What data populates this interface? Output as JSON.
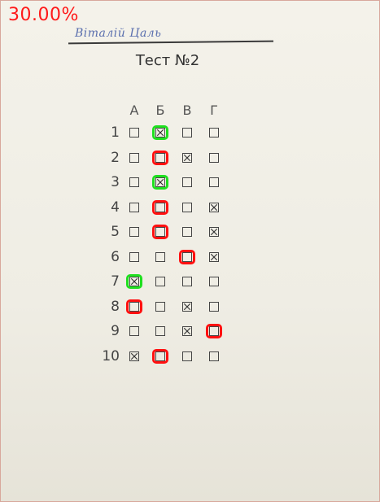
{
  "score": "30.00%",
  "student_name": "Віталій Цаль",
  "title": "Тест №2",
  "columns": [
    "А",
    "Б",
    "В",
    "Г"
  ],
  "colors": {
    "correct": "#1fe01f",
    "wrong": "#ff1010",
    "score": "#ff1a1a"
  },
  "rows": [
    {
      "num": "1",
      "marked": 1,
      "result": "correct",
      "ring": 1
    },
    {
      "num": "2",
      "marked": 2,
      "result": "wrong",
      "ring": 1
    },
    {
      "num": "3",
      "marked": 1,
      "result": "correct",
      "ring": 1
    },
    {
      "num": "4",
      "marked": 3,
      "result": "wrong",
      "ring": 1
    },
    {
      "num": "5",
      "marked": 3,
      "result": "wrong",
      "ring": 1
    },
    {
      "num": "6",
      "marked": 3,
      "result": "wrong",
      "ring": 2
    },
    {
      "num": "7",
      "marked": 0,
      "result": "correct",
      "ring": 0
    },
    {
      "num": "8",
      "marked": 2,
      "result": "wrong",
      "ring": 0
    },
    {
      "num": "9",
      "marked": 2,
      "result": "wrong",
      "ring": 3
    },
    {
      "num": "10",
      "marked": 0,
      "result": "wrong",
      "ring": 1
    }
  ]
}
